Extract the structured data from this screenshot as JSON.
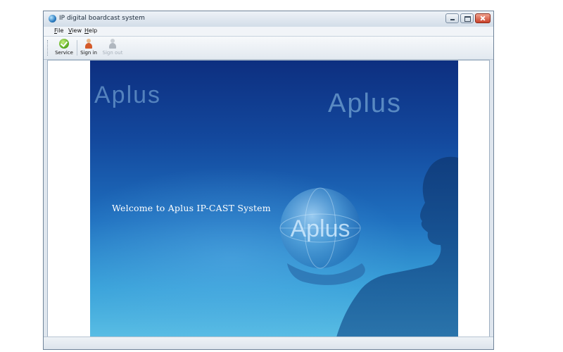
{
  "window": {
    "title": "IP digital boardcast system"
  },
  "menu": {
    "file": "File",
    "view": "View",
    "help": "Help"
  },
  "toolbar": {
    "service": "Service",
    "sign_in": "Sign in",
    "sign_out": "Sign out"
  },
  "banner": {
    "brand": "Aplus",
    "globe_brand": "Aplus",
    "welcome": "Welcome to  Aplus IP-CAST System",
    "colors": {
      "top": "#0d2f80",
      "bottom": "#59bde4"
    }
  },
  "icons": {
    "app": "globe-icon",
    "service": "check-icon",
    "sign_in": "user-icon",
    "sign_out": "user-disabled-icon"
  }
}
